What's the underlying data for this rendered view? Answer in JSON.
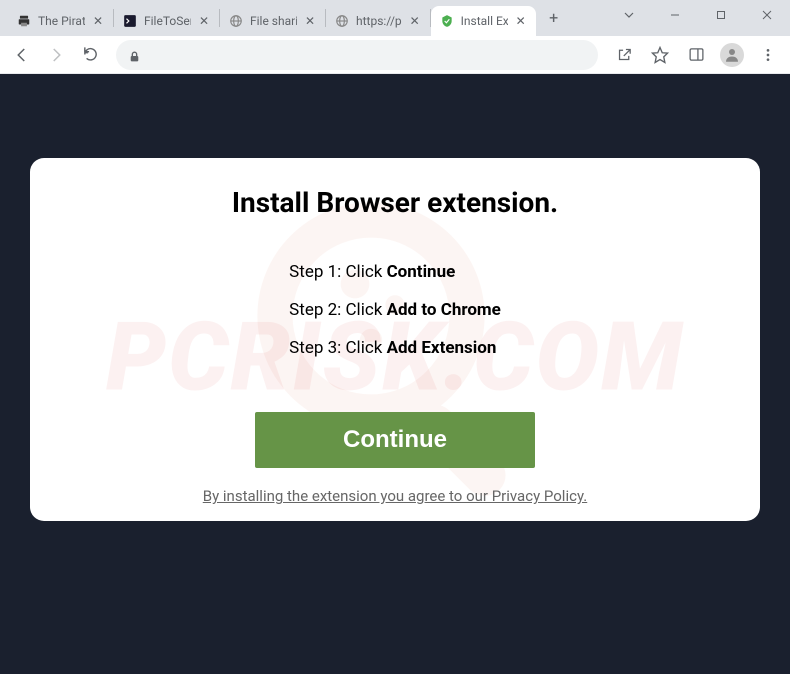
{
  "tabs": [
    {
      "title": "The Pirat",
      "favicon": "printer"
    },
    {
      "title": "FileToSen",
      "favicon": "dark"
    },
    {
      "title": "File shari",
      "favicon": "globe"
    },
    {
      "title": "https://p",
      "favicon": "globe"
    },
    {
      "title": "Install Ex",
      "favicon": "shield",
      "active": true
    }
  ],
  "newTab": "+",
  "card": {
    "title": "Install Browser extension.",
    "steps": [
      {
        "pre": "Step 1: Click ",
        "bold": "Continue"
      },
      {
        "pre": "Step 2: Click ",
        "bold": "Add to Chrome"
      },
      {
        "pre": "Step 3: Click ",
        "bold": "Add Extension"
      }
    ],
    "button": "Continue",
    "policy": "By installing the extension you agree to our Privacy Policy."
  },
  "watermark": "PCRISK.COM"
}
